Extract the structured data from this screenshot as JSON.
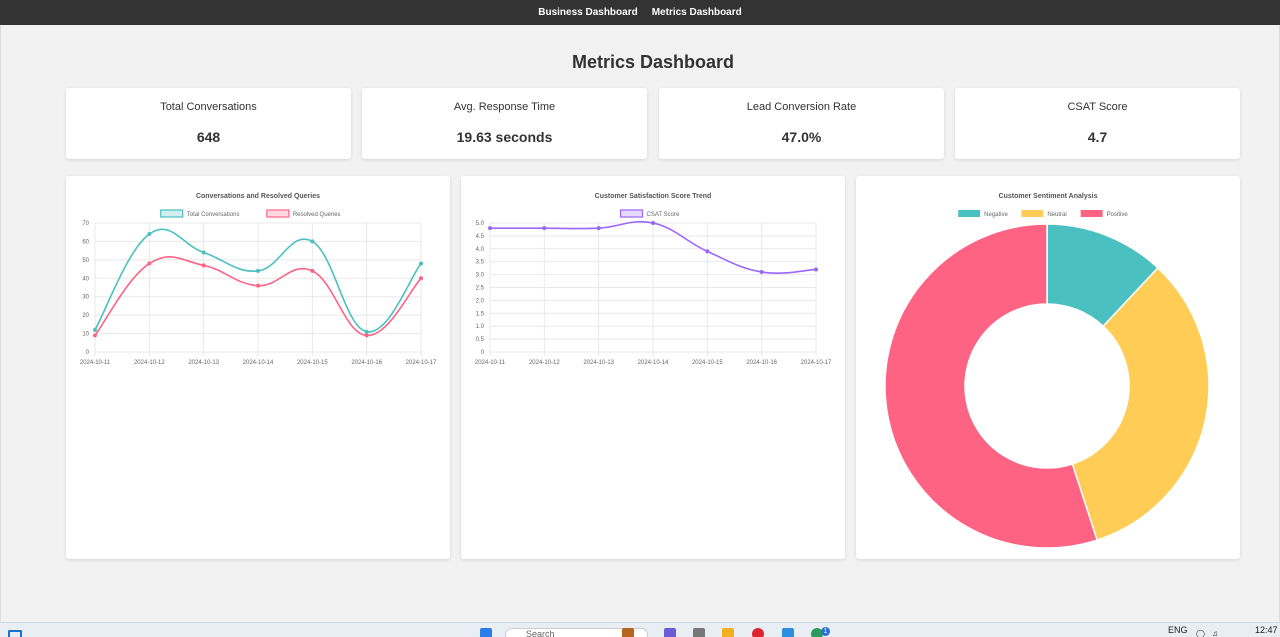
{
  "nav": {
    "links": [
      "Business Dashboard",
      "Metrics Dashboard"
    ]
  },
  "page": {
    "title": "Metrics Dashboard"
  },
  "kpis": [
    {
      "label": "Total Conversations",
      "value": "648"
    },
    {
      "label": "Avg. Response Time",
      "value": "19.63 seconds"
    },
    {
      "label": "Lead Conversion Rate",
      "value": "47.0%"
    },
    {
      "label": "CSAT Score",
      "value": "4.7"
    }
  ],
  "colors": {
    "teal": "#4bc0c0",
    "pink": "#ff6384",
    "purple": "#9966ff",
    "yellow": "#ffcd56",
    "nav": "#333333"
  },
  "chart_data": [
    {
      "type": "line",
      "title": "Conversations and Resolved Queries",
      "x": [
        "2024-10-11",
        "2024-10-12",
        "2024-10-13",
        "2024-10-14",
        "2024-10-15",
        "2024-10-16",
        "2024-10-17"
      ],
      "series": [
        {
          "name": "Total Conversations",
          "values": [
            12,
            64,
            54,
            44,
            60,
            11,
            48
          ],
          "color": "#4bc0c0"
        },
        {
          "name": "Resolved Queries",
          "values": [
            9,
            48,
            47,
            36,
            44,
            9,
            40
          ],
          "color": "#ff6384"
        }
      ],
      "ylim": [
        0,
        70
      ],
      "yticks": [
        0,
        10,
        20,
        30,
        40,
        50,
        60,
        70
      ],
      "grid": true,
      "legend": "top"
    },
    {
      "type": "line",
      "title": "Customer Satisfaction Score Trend",
      "x": [
        "2024-10-11",
        "2024-10-12",
        "2024-10-13",
        "2024-10-14",
        "2024-10-15",
        "2024-10-16",
        "2024-10-17"
      ],
      "series": [
        {
          "name": "CSAT Score",
          "values": [
            4.8,
            4.8,
            4.8,
            5.0,
            3.9,
            3.1,
            3.2
          ],
          "color": "#9966ff"
        }
      ],
      "ylim": [
        0,
        5
      ],
      "yticks": [
        "0",
        "0.5",
        "1.0",
        "1.5",
        "2.0",
        "2.5",
        "3.0",
        "3.5",
        "4.0",
        "4.5",
        "5.0"
      ],
      "grid": true,
      "legend": "top"
    },
    {
      "type": "pie",
      "title": "Customer Sentiment Analysis",
      "categories": [
        "Negative",
        "Neutral",
        "Positive"
      ],
      "values": [
        12,
        33,
        55
      ],
      "colors": [
        "#4bc0c0",
        "#ffcd56",
        "#ff6384"
      ],
      "legend": "top"
    }
  ],
  "taskbar": {
    "search": "Search",
    "lang": "ENG",
    "time": "12:47",
    "badge": "1"
  }
}
